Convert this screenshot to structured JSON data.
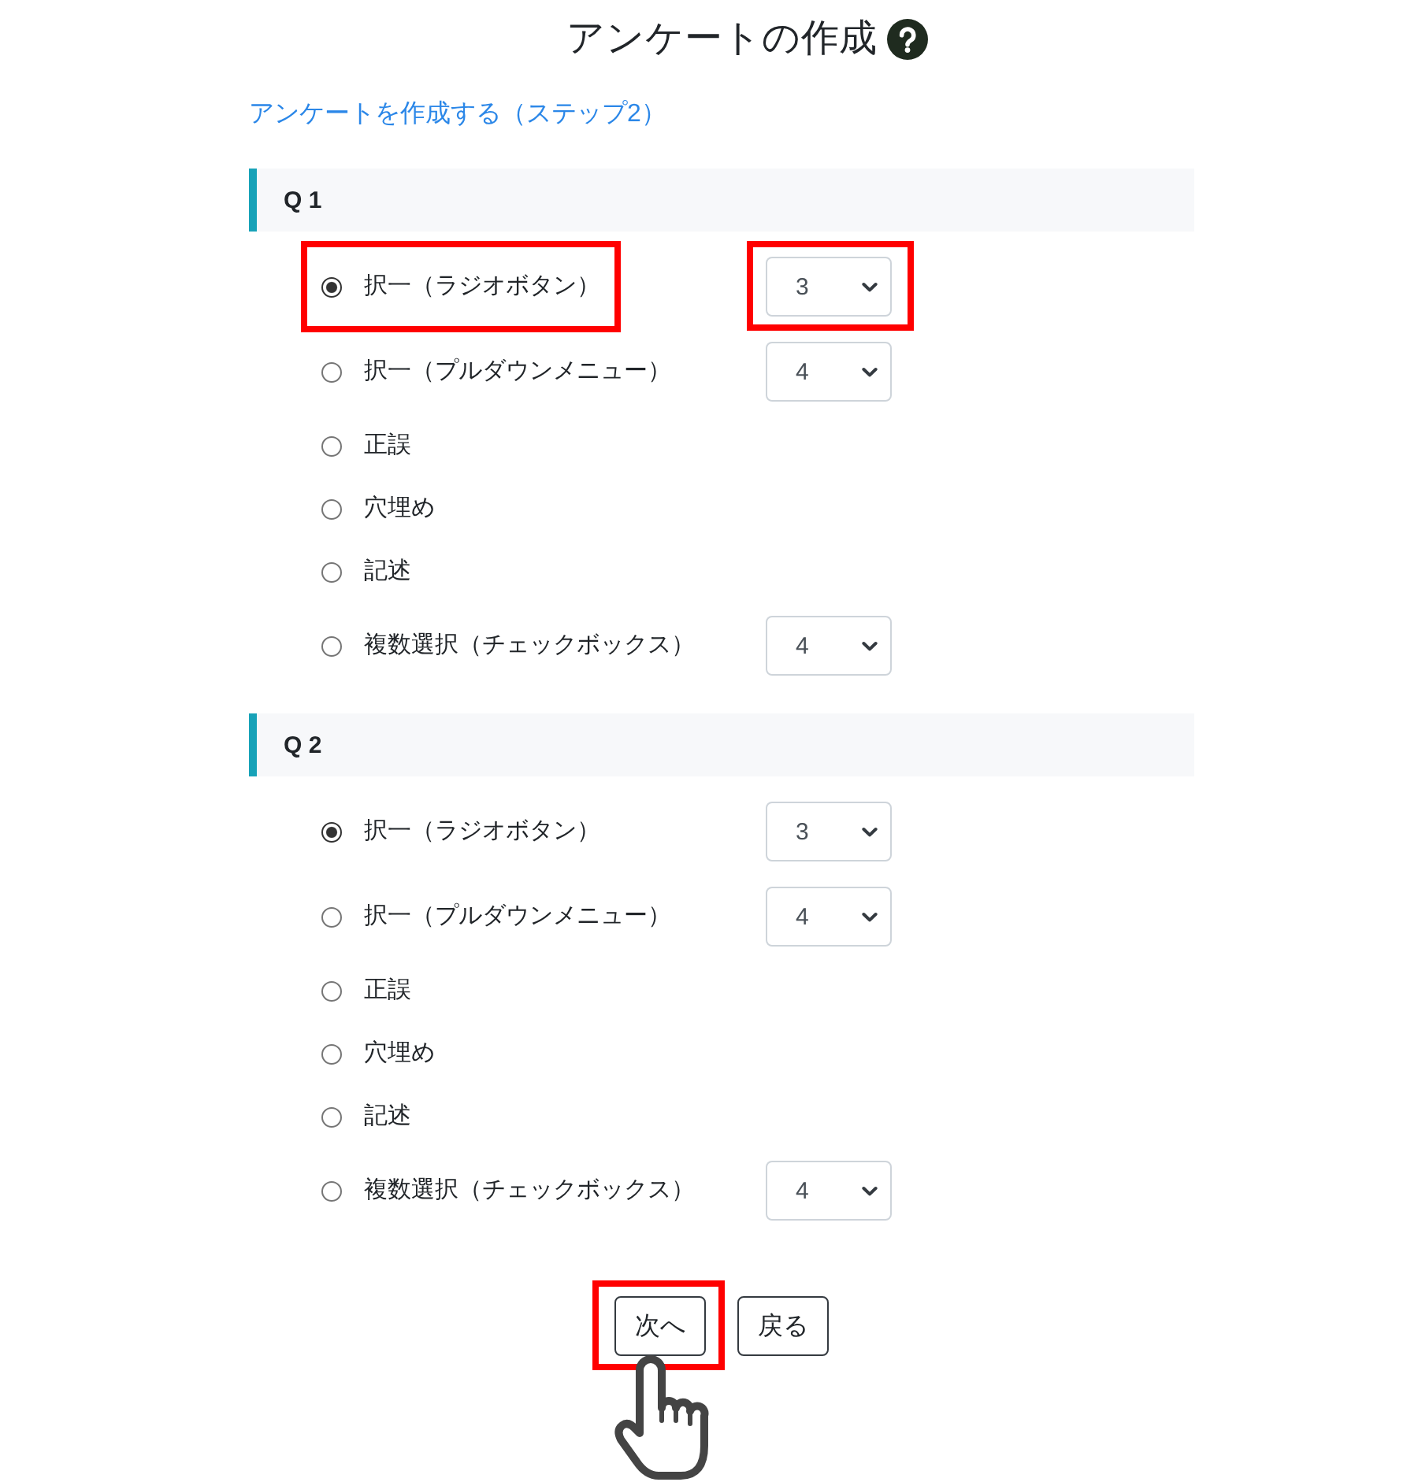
{
  "page_title": "アンケートの作成",
  "step_link": "アンケートを作成する（ステップ2）",
  "questions": [
    {
      "label": "Q 1",
      "options": [
        {
          "label": "択一（ラジオボタン）",
          "selected": true,
          "highlighted": true,
          "select": {
            "value": "3",
            "highlighted": true
          }
        },
        {
          "label": "択一（プルダウンメニュー）",
          "selected": false,
          "highlighted": false,
          "select": {
            "value": "4",
            "highlighted": false
          }
        },
        {
          "label": "正誤",
          "selected": false,
          "highlighted": false
        },
        {
          "label": "穴埋め",
          "selected": false,
          "highlighted": false
        },
        {
          "label": "記述",
          "selected": false,
          "highlighted": false
        },
        {
          "label": "複数選択（チェックボックス）",
          "selected": false,
          "highlighted": false,
          "select": {
            "value": "4",
            "highlighted": false
          }
        }
      ]
    },
    {
      "label": "Q 2",
      "options": [
        {
          "label": "択一（ラジオボタン）",
          "selected": true,
          "highlighted": false,
          "select": {
            "value": "3",
            "highlighted": false
          }
        },
        {
          "label": "択一（プルダウンメニュー）",
          "selected": false,
          "highlighted": false,
          "select": {
            "value": "4",
            "highlighted": false
          }
        },
        {
          "label": "正誤",
          "selected": false,
          "highlighted": false
        },
        {
          "label": "穴埋め",
          "selected": false,
          "highlighted": false
        },
        {
          "label": "記述",
          "selected": false,
          "highlighted": false
        },
        {
          "label": "複数選択（チェックボックス）",
          "selected": false,
          "highlighted": false,
          "select": {
            "value": "4",
            "highlighted": false
          }
        }
      ]
    }
  ],
  "buttons": [
    {
      "label": "次へ",
      "highlighted": true,
      "pointer_cursor": true
    },
    {
      "label": "戻る",
      "highlighted": false,
      "pointer_cursor": false
    }
  ]
}
